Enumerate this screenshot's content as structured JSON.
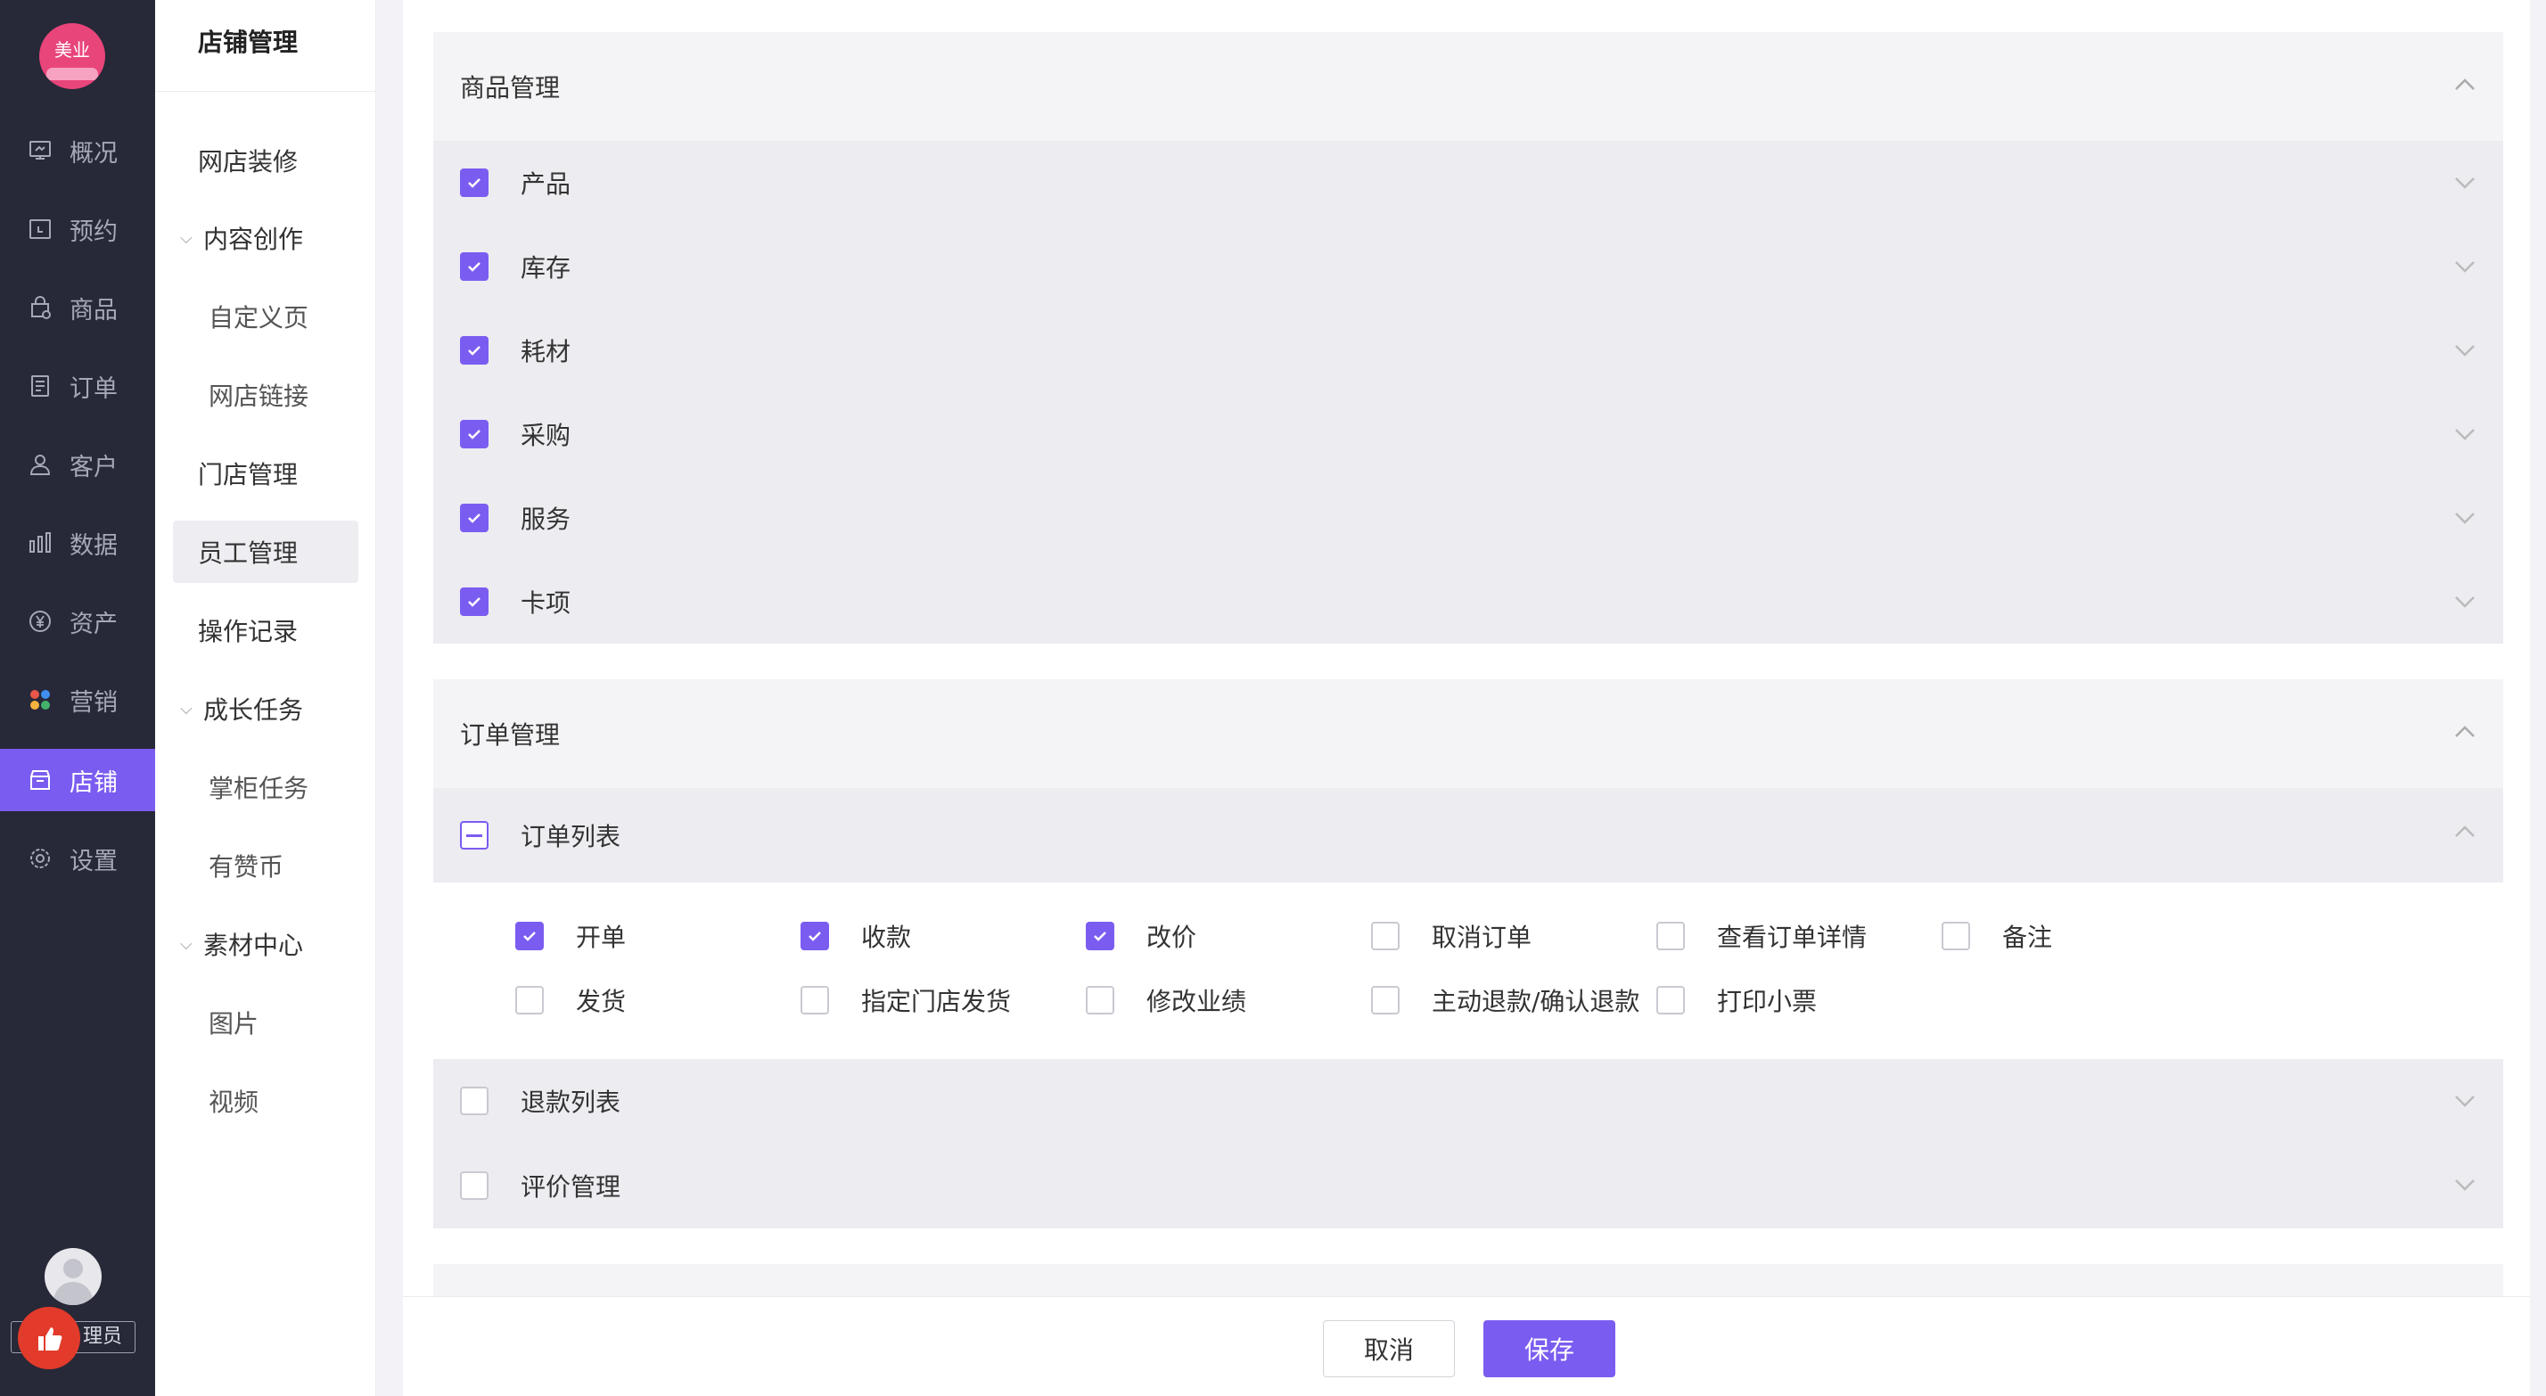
{
  "brand": {
    "logo_text": "美业",
    "accent": "#7b5cf0"
  },
  "rail": {
    "items": [
      {
        "label": "概况",
        "icon": "monitor-icon"
      },
      {
        "label": "预约",
        "icon": "calendar-icon"
      },
      {
        "label": "商品",
        "icon": "bag-icon"
      },
      {
        "label": "订单",
        "icon": "list-icon"
      },
      {
        "label": "客户",
        "icon": "user-icon"
      },
      {
        "label": "数据",
        "icon": "bar-chart-icon"
      },
      {
        "label": "资产",
        "icon": "yen-icon"
      },
      {
        "label": "营销",
        "icon": "clover-icon"
      },
      {
        "label": "店铺",
        "icon": "store-icon",
        "active": true
      },
      {
        "label": "设置",
        "icon": "gear-icon"
      }
    ],
    "role_label": "理员"
  },
  "subnav": {
    "title": "店铺管理",
    "items": [
      {
        "label": "网店装修"
      },
      {
        "label": "内容创作"
      },
      {
        "label": "自定义页"
      },
      {
        "label": "网店链接"
      },
      {
        "label": "门店管理"
      },
      {
        "label": "员工管理"
      },
      {
        "label": "操作记录"
      },
      {
        "label": "成长任务"
      },
      {
        "label": "掌柜任务"
      },
      {
        "label": "有赞币"
      },
      {
        "label": "素材中心"
      },
      {
        "label": "图片"
      },
      {
        "label": "视频"
      }
    ]
  },
  "sections": {
    "goods": {
      "title": "商品管理",
      "rows": [
        "产品",
        "库存",
        "耗材",
        "采购",
        "服务",
        "卡项"
      ]
    },
    "order": {
      "title": "订单管理",
      "order_list": {
        "label": "订单列表",
        "perms": [
          {
            "label": "开单",
            "checked": true
          },
          {
            "label": "收款",
            "checked": true
          },
          {
            "label": "改价",
            "checked": true
          },
          {
            "label": "取消订单",
            "checked": false
          },
          {
            "label": "查看订单详情",
            "checked": false
          },
          {
            "label": "备注",
            "checked": false
          },
          {
            "label": "发货",
            "checked": false
          },
          {
            "label": "指定门店发货",
            "checked": false
          },
          {
            "label": "修改业绩",
            "checked": false
          },
          {
            "label": "主动退款/确认退款",
            "checked": false
          },
          {
            "label": "打印小票",
            "checked": false
          }
        ]
      },
      "refund_list": "退款列表",
      "review": "评价管理"
    }
  },
  "footer": {
    "cancel_label": "取消",
    "save_label": "保存"
  }
}
